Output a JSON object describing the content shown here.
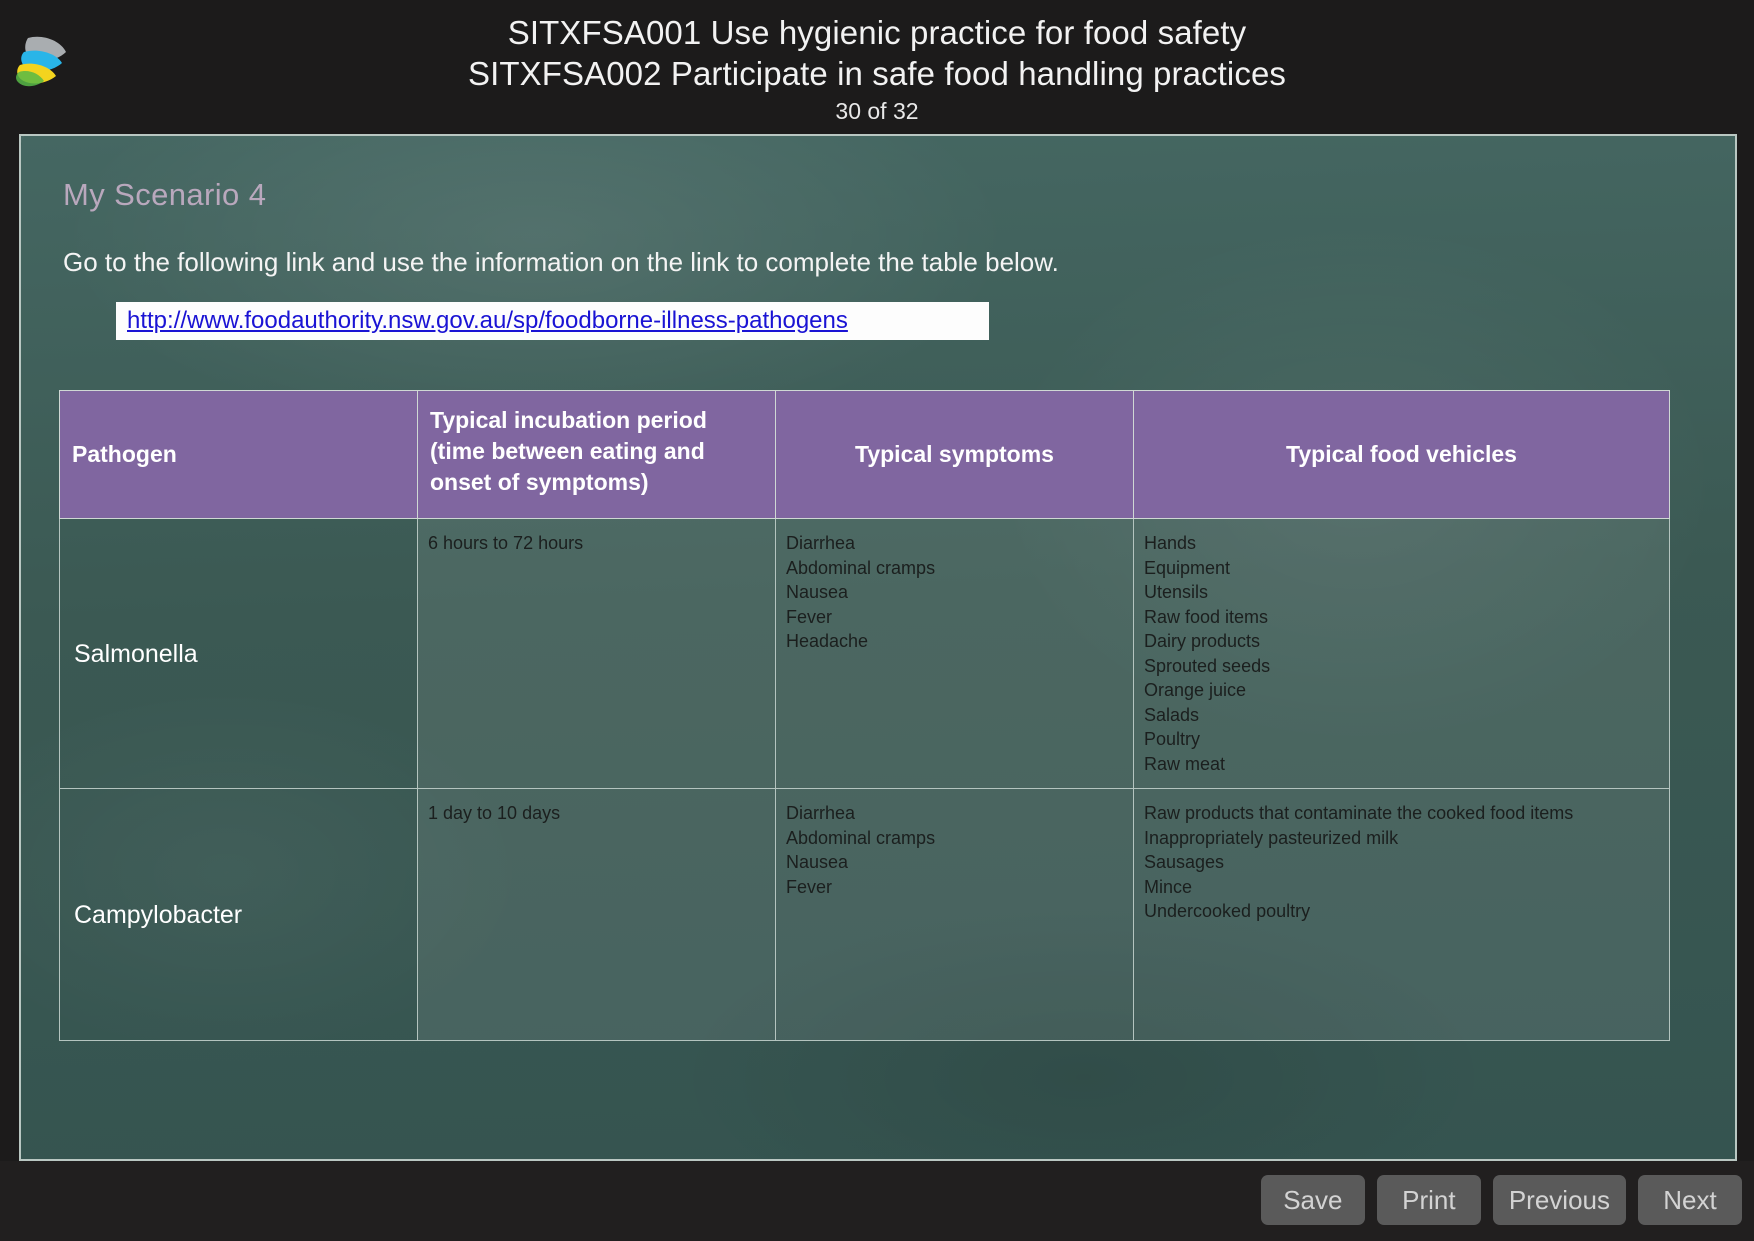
{
  "header": {
    "logo_icon": "leaf-wing-logo",
    "title_line_1": "SITXFSA001  Use hygienic practice for food safety",
    "title_line_2": "SITXFSA002  Participate in safe food handling practices",
    "page_counter": "30 of 32"
  },
  "content": {
    "scenario_title": "My Scenario 4",
    "instruction": "Go to the following link and use the information on the link to complete the table below.",
    "link_text": "http://www.foodauthority.nsw.gov.au/sp/foodborne-illness-pathogens",
    "link_color": "#1a13d4"
  },
  "table": {
    "header_background": "#8066a0",
    "columns": [
      "Pathogen",
      "Typical incubation period (time between eating and onset of symptoms)",
      "Typical symptoms",
      "Typical food vehicles"
    ],
    "column_headers": {
      "pathogen": "Pathogen",
      "incubation_line_1": "Typical incubation period",
      "incubation_line_2": "(time between eating and",
      "incubation_line_3": "onset of symptoms)",
      "symptoms": "Typical symptoms",
      "vehicles": "Typical food vehicles"
    },
    "rows": [
      {
        "pathogen": "Salmonella",
        "incubation": "6 hours to 72 hours",
        "symptoms": "Diarrhea\nAbdominal cramps\nNausea\nFever\nHeadache",
        "vehicles": "Hands\nEquipment\nUtensils\nRaw food items\nDairy products\nSprouted seeds\nOrange juice\nSalads\nPoultry\nRaw meat"
      },
      {
        "pathogen": "Campylobacter",
        "incubation": "1 day to 10 days",
        "symptoms": "Diarrhea\nAbdominal cramps\nNausea\nFever",
        "vehicles": "Raw products that contaminate the cooked food items\nInappropriately pasteurized milk\nSausages\nMince\nUndercooked poultry"
      }
    ]
  },
  "footer": {
    "buttons": [
      {
        "label": "Save",
        "name": "save-button"
      },
      {
        "label": "Print",
        "name": "print-button"
      },
      {
        "label": "Previous",
        "name": "previous-button"
      },
      {
        "label": "Next",
        "name": "next-button"
      }
    ]
  }
}
